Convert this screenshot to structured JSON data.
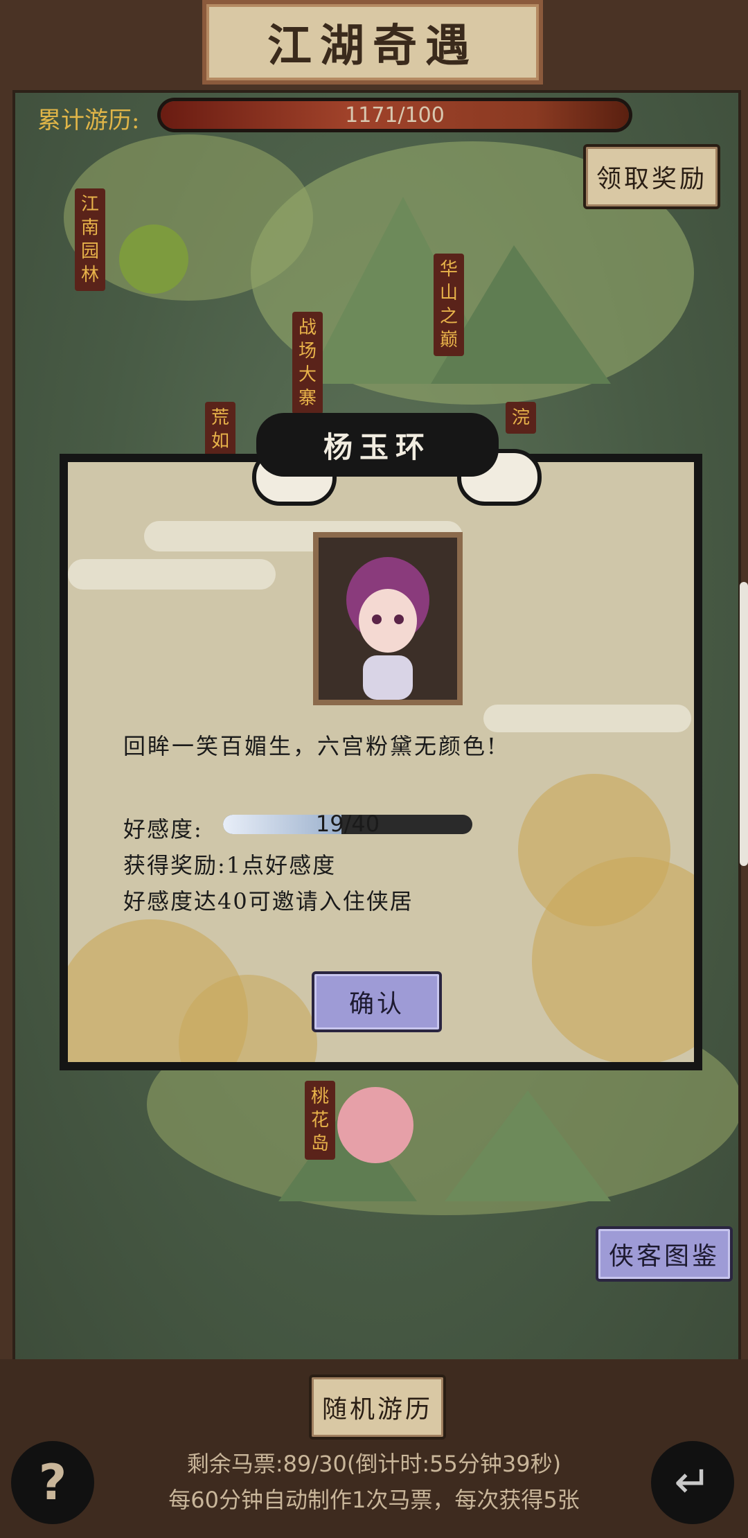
{
  "header": {
    "title": "江湖奇遇"
  },
  "experience": {
    "label": "累计游历:",
    "value_text": "1171/100"
  },
  "buttons": {
    "claim_reward": "领取奖励",
    "hero_gallery": "侠客图鉴",
    "random_travel": "随机游历"
  },
  "map": {
    "places": [
      "江南园林",
      "华山之巅",
      "战场大寨",
      "荒如",
      "浣",
      "桃花岛"
    ],
    "signboard": "华山之巅"
  },
  "modal": {
    "character_name": "杨玉环",
    "quote": "回眸一笑百媚生，六宫粉黛无颜色!",
    "favor_label": "好感度:",
    "favor_text": "19/40",
    "favor_progress": 0.475,
    "reward_text": "获得奖励:1点好感度",
    "invite_text": "好感度达40可邀请入住侠居",
    "confirm": "确认"
  },
  "footer": {
    "tickets_text": "剩余马票:89/30(倒计时:55分钟39秒)",
    "auto_text": "每60分钟自动制作1次马票，每次获得5张",
    "help_icon": "question-mark-icon",
    "back_icon": "return-arrow-icon"
  },
  "colors": {
    "accent_gold": "#e0b548",
    "button_purple": "#9e9bd6",
    "plate": "#d9c8a4"
  }
}
